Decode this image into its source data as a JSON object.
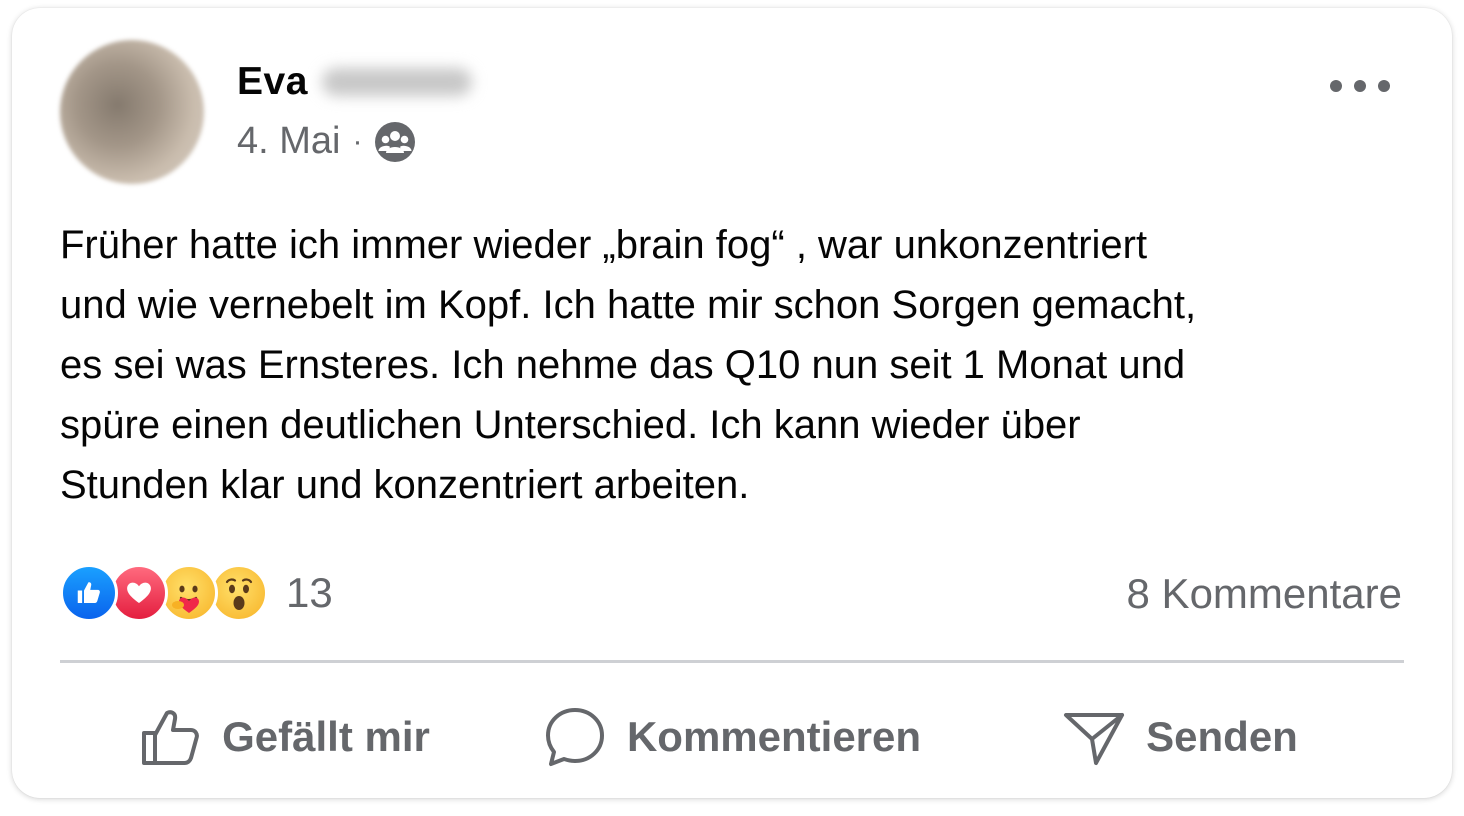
{
  "post": {
    "author_first_name": "Eva",
    "date": "4. Mai",
    "separator": "·",
    "audience_icon": "friends-group-icon",
    "more_icon": "more-horizontal-icon",
    "text": "Früher hatte ich immer wieder „brain fog“ , war unkonzentriert\nund wie vernebelt im Kopf. Ich hatte mir schon Sorgen gemacht,\nes sei was Ernsteres. Ich nehme das Q10 nun seit 1 Monat und\nspüre einen deutlichen Unterschied. Ich kann wieder über\nStunden klar und konzentriert arbeiten."
  },
  "reactions": {
    "icons": [
      "like-reaction-icon",
      "love-reaction-icon",
      "care-reaction-icon",
      "wow-reaction-icon"
    ],
    "count": "13",
    "comments_label": "8 Kommentare"
  },
  "actions": {
    "like_label": "Gefällt mir",
    "comment_label": "Kommentieren",
    "send_label": "Senden"
  },
  "colors": {
    "text_primary": "#050505",
    "text_secondary": "#65676b",
    "divider": "#ced0d4",
    "like_blue": "#0a63ed",
    "love_red": "#e41e3f",
    "emoji_yellow": "#f7b125"
  }
}
